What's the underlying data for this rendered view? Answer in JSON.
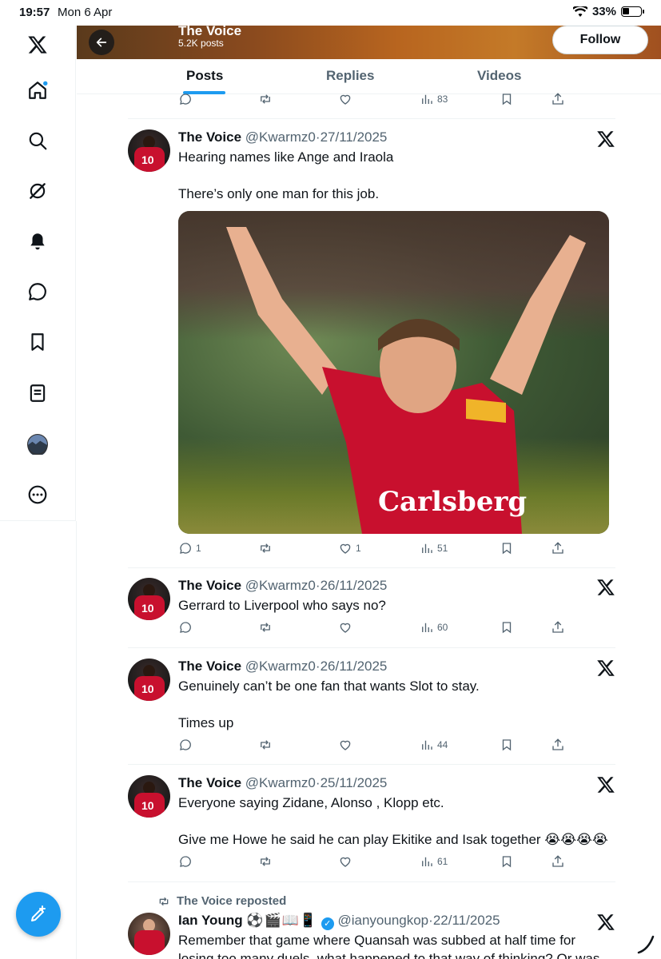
{
  "status_bar": {
    "time": "19:57",
    "date": "Mon 6 Apr",
    "battery": "33%"
  },
  "profile_header": {
    "name": "The Voice",
    "post_count": "5.2K posts",
    "follow_label": "Follow"
  },
  "tabs": [
    {
      "label": "Posts",
      "active": true
    },
    {
      "label": "Replies",
      "active": false
    },
    {
      "label": "Videos",
      "active": false
    }
  ],
  "top_partial_actions": {
    "views": "83"
  },
  "posts": [
    {
      "name": "The Voice",
      "handle": "@Kwarmz0",
      "date": "27/11/2025",
      "line1": "Hearing names like Ange and Iraola",
      "line2": "There’s only one man for this job.",
      "replies": "1",
      "likes": "1",
      "views": "51"
    },
    {
      "name": "The Voice",
      "handle": "@Kwarmz0",
      "date": "26/11/2025",
      "line1": "Gerrard to Liverpool who says no?",
      "views": "60"
    },
    {
      "name": "The Voice",
      "handle": "@Kwarmz0",
      "date": "26/11/2025",
      "line1": "Genuinely can’t be one fan that wants Slot to stay.",
      "line2": "Times up",
      "views": "44"
    },
    {
      "name": "The Voice",
      "handle": "@Kwarmz0",
      "date": "25/11/2025",
      "line1": "Everyone saying Zidane, Alonso , Klopp etc.",
      "line2": "Give me Howe he said he can play Ekitike and Isak together 😭😭😭😭",
      "views": "61"
    }
  ],
  "repost": {
    "reposted_label": "The Voice reposted",
    "name": "Ian Young",
    "name_emojis": "⚽🎬📖📱",
    "handle": "@ianyoungkop",
    "date": "22/11/2025",
    "line1": "Remember that game where Quansah was subbed at half time for",
    "line2": "losing too many duels, what happened to that way of thinking? Or was"
  },
  "meta_separator": "·",
  "icons": {
    "app_logo": "x-logo-icon",
    "nav": [
      "home-icon",
      "search-icon",
      "grok-icon",
      "notifications-icon",
      "messages-icon",
      "bookmarks-icon",
      "lists-icon",
      "profile-avatar",
      "more-icon"
    ],
    "compose": "compose-post-icon"
  },
  "colors": {
    "accent": "#1d9bf0",
    "text": "#0f1419",
    "muted": "#536471",
    "liverpool_red": "#c8102e"
  }
}
